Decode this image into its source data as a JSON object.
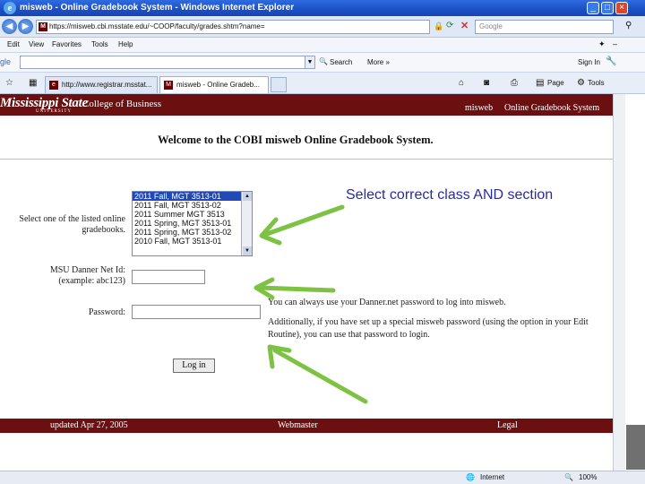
{
  "window": {
    "title": "misweb - Online Gradebook System - Windows Internet Explorer",
    "controls": [
      "_",
      "□",
      "×"
    ]
  },
  "browser": {
    "address": "https://misweb.cbi.msstate.edu/~COOP/faculty/grades.shtm?name=",
    "search_placeholder": "Google",
    "menu": [
      "Edit",
      "View",
      "Favorites",
      "Tools",
      "Help"
    ],
    "google": {
      "logo": "gle",
      "search_label": "Search",
      "more_label": "More »",
      "signin_label": "Sign In"
    },
    "tabs": [
      {
        "label": "http://www.registrar.msstat..."
      },
      {
        "label": "misweb - Online Gradeb..."
      }
    ],
    "toolbar": {
      "page_label": "Page",
      "tools_label": "Tools"
    },
    "status": {
      "zone": "Internet",
      "zoom": "100%"
    }
  },
  "site": {
    "logo_text": "Mississippi State",
    "logo_sub": "UNIVERSITY",
    "college": "College of Business",
    "nav": [
      "misweb",
      "Online Gradebook System"
    ],
    "welcome": "Welcome to the COBI misweb Online Gradebook System."
  },
  "form": {
    "gradebook_label_1": "Select one of the listed online",
    "gradebook_label_2": "gradebooks.",
    "gradebooks": [
      "2011 Fall, MGT 3513-01",
      "2011 Fall, MGT 3513-02",
      "2011 Summer MGT 3513",
      "2011 Spring, MGT 3513-01",
      "2011 Spring, MGT 3513-02",
      "2010 Fall, MGT 3513-01"
    ],
    "selected_index": 0,
    "netid_label_1": "MSU Danner Net Id:",
    "netid_label_2": "(example: abc123)",
    "netid_value": "",
    "password_label": "Password:",
    "password_value": "",
    "login_label": "Log in",
    "note_1": "You can always use your Danner.net password to log into misweb.",
    "note_2a": "Additionally, if you have set up a special misweb password (using the option in your Edit",
    "note_2b": "Routine), you can use that password to login."
  },
  "annotation": {
    "text": "Select correct class AND section",
    "arrow_color": "#7dc243"
  },
  "footer": {
    "updated": "updated Apr 27, 2005",
    "webmaster": "Webmaster",
    "legal": "Legal"
  },
  "colors": {
    "maroon": "#6b0f10",
    "selection": "#2249b8"
  }
}
